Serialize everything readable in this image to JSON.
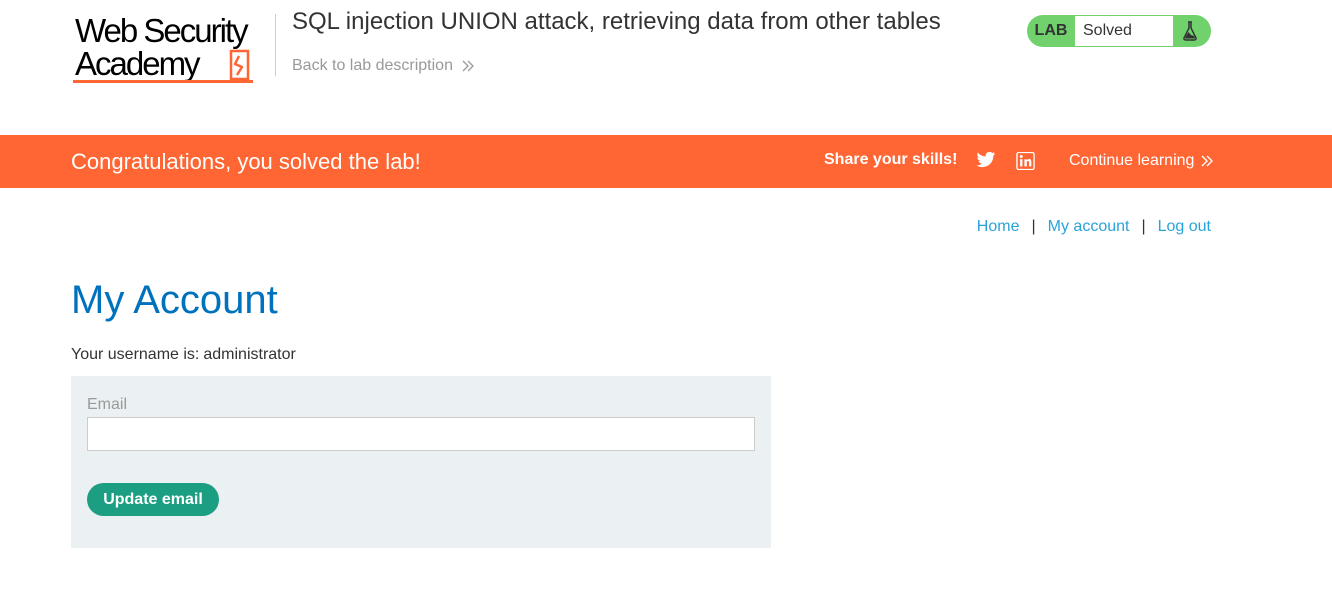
{
  "header": {
    "logo_line1": "Web Security",
    "logo_line2": "Academy",
    "lab_title": "SQL injection UNION attack, retrieving data from other tables",
    "back_link": "Back to lab description",
    "lab_badge": "LAB",
    "lab_status": "Solved"
  },
  "banner": {
    "message": "Congratulations, you solved the lab!",
    "share_label": "Share your skills!",
    "continue_label": "Continue learning"
  },
  "nav": {
    "home": "Home",
    "separator": "|",
    "my_account": "My account",
    "log_out": "Log out"
  },
  "main": {
    "title": "My Account",
    "username_label": "Your username is:",
    "username_value": "administrator",
    "email_label": "Email",
    "email_value": "",
    "update_button": "Update email"
  },
  "colors": {
    "accent": "#ff6633",
    "title_blue": "#0071bc",
    "link_blue": "#29a3d8",
    "lab_green": "#70d16d",
    "button_green": "#1c9e82",
    "panel_bg": "#ebf0f2"
  },
  "icons": [
    "web-security-academy-logo",
    "chevron-double-right-icon",
    "flask-icon",
    "twitter-icon",
    "linkedin-icon"
  ]
}
